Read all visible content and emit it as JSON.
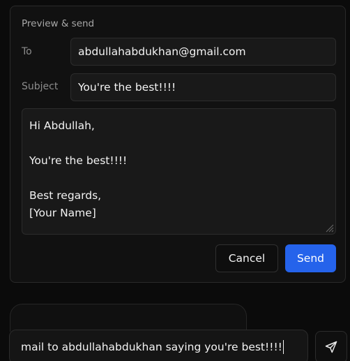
{
  "preview": {
    "title": "Preview & send",
    "to_label": "To",
    "to_value": "abdullahabdukhan@gmail.com",
    "subject_label": "Subject",
    "subject_value": "You're the best!!!!",
    "body_lines": [
      "Hi Abdullah,",
      "",
      "You're the best!!!!",
      "",
      "Best regards,",
      "[Your Name]"
    ],
    "cancel_label": "Cancel",
    "send_label": "Send"
  },
  "composer": {
    "value": "mail to abdullahabdukhan saying you're best!!!!",
    "send_icon": "paper-plane-icon"
  },
  "colors": {
    "background": "#0b0b0b",
    "card": "#111111",
    "input": "#191919",
    "border": "#2c2c2c",
    "accent": "#2563eb",
    "text": "#f3f3f3",
    "muted": "#8c8c8c"
  }
}
